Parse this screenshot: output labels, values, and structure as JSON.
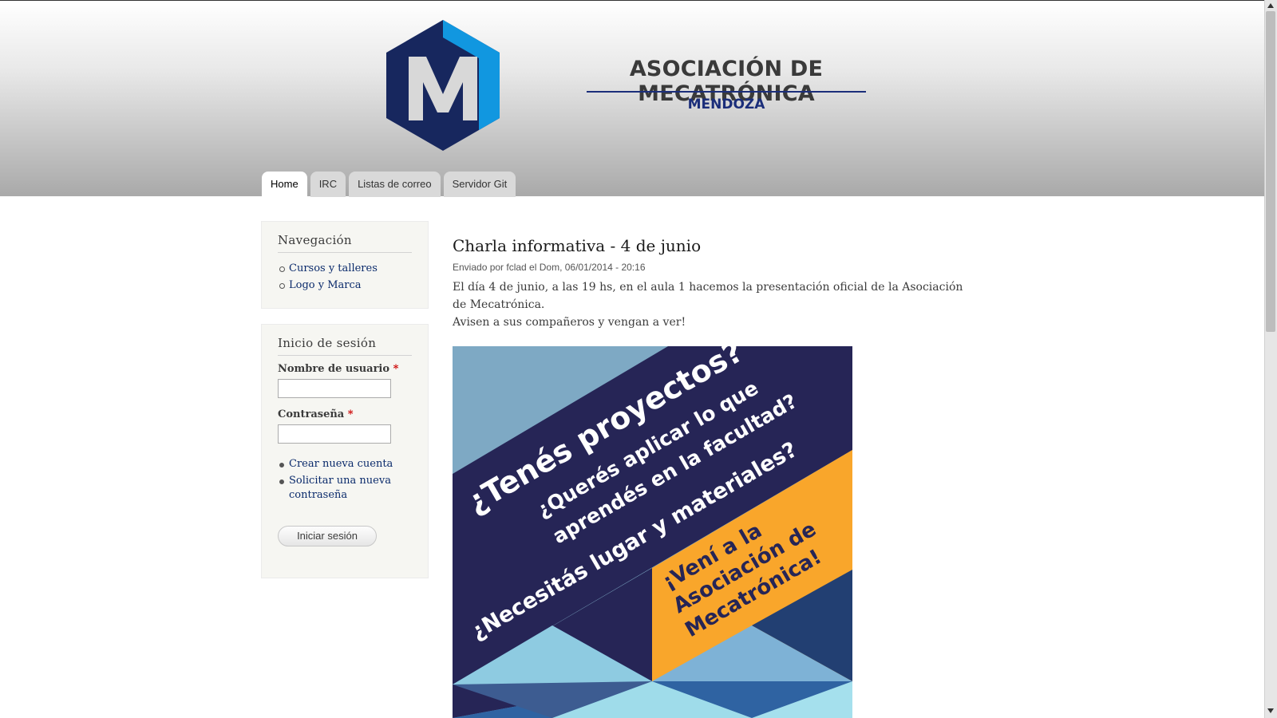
{
  "site": {
    "name": "ASOCIACIÓN DE MECATRÓNICA",
    "slogan": "MENDOZA",
    "logo_letter": "M",
    "colors": {
      "logo_dark": "#17275e",
      "logo_light": "#1197e0",
      "slogan": "#1b2e7a"
    }
  },
  "tabs": [
    {
      "label": "Home",
      "active": true
    },
    {
      "label": "IRC",
      "active": false
    },
    {
      "label": "Listas de correo",
      "active": false
    },
    {
      "label": "Servidor Git",
      "active": false
    }
  ],
  "navigation": {
    "title": "Navegación",
    "items": [
      {
        "label": "Cursos y talleres"
      },
      {
        "label": "Logo y Marca"
      }
    ]
  },
  "login": {
    "title": "Inicio de sesión",
    "username_label": "Nombre de usuario",
    "password_label": "Contraseña",
    "required_mark": "*",
    "username_value": "",
    "password_value": "",
    "links": [
      {
        "label": "Crear nueva cuenta"
      },
      {
        "label": "Solicitar una nueva contraseña"
      }
    ],
    "submit_label": "Iniciar sesión"
  },
  "article": {
    "title": "Charla informativa - 4 de junio",
    "meta": "Enviado por fclad el Dom, 06/01/2014 - 20:16",
    "paragraph1": "El día 4 de junio, a las 19 hs, en el aula 1 hacemos la presentación oficial de la Asociación de Mecatrónica.",
    "paragraph2": "Avisen a sus compañeros y vengan a ver!",
    "poster": {
      "line1": "¿Tenés proyectos?",
      "line2a": "¿Querés aplicar lo que",
      "line2b": "aprendés en la facultad?",
      "line3": "¿Necesitás lugar y materiales?",
      "line4a": "¡Vení a la",
      "line4b": "Asociación de",
      "line4c": "Mecatrónica!",
      "colors": {
        "navy": "#262556",
        "orange": "#f9a62b",
        "light_blue": "#7ea9c4"
      }
    }
  }
}
